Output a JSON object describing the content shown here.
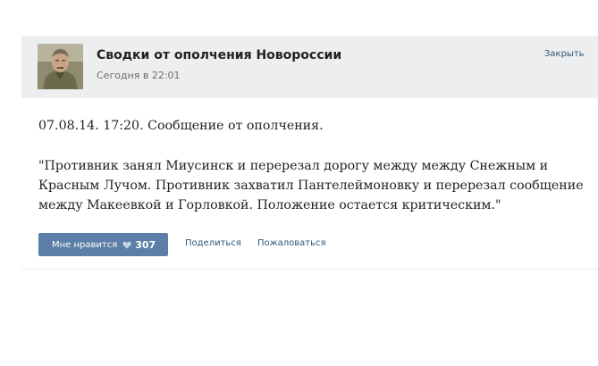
{
  "header": {
    "group_name": "Сводки от ополчения Новороссии",
    "time": "Сегодня в 22:01",
    "close_label": "Закрыть"
  },
  "post": {
    "lines": [
      "07.08.14. 17:20. Сообщение от ополчения.",
      "\"Противник занял Миусинск и перерезал дорогу между между Снежным и",
      "Красным Лучом. Противник захватил Пантелеймоновку и перерезал сообщение",
      "между Макеевкой и Горловкой. Положение остается критическим.\""
    ]
  },
  "actions": {
    "like_label": "Мне нравится",
    "like_icon": "heart-icon",
    "like_count": "307",
    "share_label": "Поделиться",
    "report_label": "Пожаловаться"
  },
  "colors": {
    "header_bg": "#edeef0",
    "link": "#2b587a",
    "like_button": "#5b7fa6"
  }
}
